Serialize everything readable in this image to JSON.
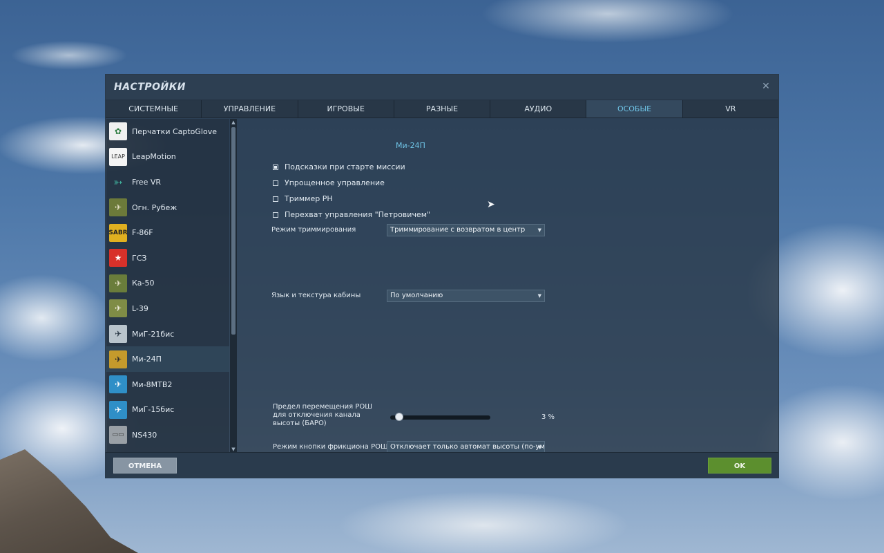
{
  "window": {
    "title": "НАСТРОЙКИ",
    "close_icon": "close-icon"
  },
  "tabs": [
    {
      "label": "СИСТЕМНЫЕ",
      "active": false
    },
    {
      "label": "УПРАВЛЕНИЕ",
      "active": false
    },
    {
      "label": "ИГРОВЫЕ",
      "active": false
    },
    {
      "label": "РАЗНЫЕ",
      "active": false
    },
    {
      "label": "АУДИО",
      "active": false
    },
    {
      "label": "ОСОБЫЕ",
      "active": true
    },
    {
      "label": "VR",
      "active": false
    }
  ],
  "sidebar": {
    "items": [
      {
        "label": "Перчатки CaptoGlove",
        "icon": "captoglove-icon",
        "color": "#f0f0f0",
        "active": false
      },
      {
        "label": "LeapMotion",
        "icon": "leapmotion-icon",
        "color": "#f4f4f4",
        "active": false
      },
      {
        "label": "Free VR",
        "icon": "freevr-icon",
        "color": "#3fae9b",
        "active": false
      },
      {
        "label": "Огн. Рубеж",
        "icon": "fire-line-icon",
        "color": "#6c7a3a",
        "active": false
      },
      {
        "label": "F-86F",
        "icon": "f86-icon",
        "color": "#e0b020",
        "active": false
      },
      {
        "label": "ГСЗ",
        "icon": "gsz-icon",
        "color": "#d8312a",
        "active": false
      },
      {
        "label": "Ка-50",
        "icon": "ka50-icon",
        "color": "#6a7d3b",
        "active": false
      },
      {
        "label": "L-39",
        "icon": "l39-icon",
        "color": "#7f8c46",
        "active": false
      },
      {
        "label": "МиГ-21бис",
        "icon": "mig21-icon",
        "color": "#b9c4cc",
        "active": false
      },
      {
        "label": "Ми-24П",
        "icon": "mi24-icon",
        "color": "#c49a2c",
        "active": true
      },
      {
        "label": "Ми-8МТВ2",
        "icon": "mi8-icon",
        "color": "#2f8fc7",
        "active": false
      },
      {
        "label": "МиГ-15бис",
        "icon": "mig15-icon",
        "color": "#2f8fc7",
        "active": false
      },
      {
        "label": "NS430",
        "icon": "ns430-icon",
        "color": "#9aa0a6",
        "active": false
      }
    ]
  },
  "content": {
    "section_title": "Ми-24П",
    "checkboxes": [
      {
        "label": "Подсказки при старте миссии",
        "checked": true
      },
      {
        "label": "Упрощенное управление",
        "checked": false
      },
      {
        "label": "Триммер РН",
        "checked": false
      },
      {
        "label": "Перехват управления \"Петровичем\"",
        "checked": false
      }
    ],
    "trim_mode": {
      "label": "Режим триммирования",
      "value": "Триммирование с возвратом в центр"
    },
    "cockpit_lang": {
      "label": "Язык и текстура кабины",
      "value": "По умолчанию"
    },
    "rosh_limit": {
      "label": "Предел перемещения РОШ для отключения канала высоты (БАРО)",
      "value_text": "3  %",
      "value": 3
    },
    "friction_mode": {
      "label": "Режим кнопки фрикциона РОШ",
      "value": "Отключает только автомат высоты (по-умолч"
    }
  },
  "footer": {
    "cancel_label": "ОТМЕНА",
    "ok_label": "OK"
  },
  "colors": {
    "accent": "#6fc4e6",
    "ok_button": "#5c8f2e",
    "cancel_button": "#8795a3"
  }
}
